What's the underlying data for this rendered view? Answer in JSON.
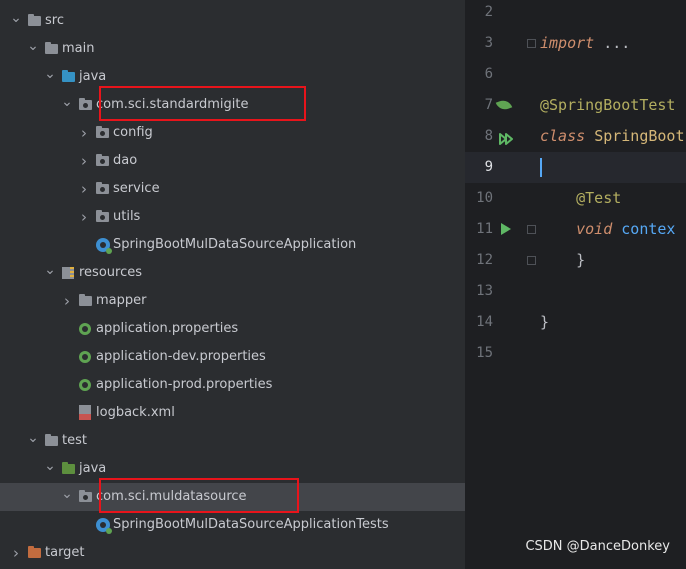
{
  "project_tree": {
    "items": [
      {
        "label": "src",
        "kind": "folder",
        "color": "gray",
        "arrow": "down",
        "depth": 0
      },
      {
        "label": "main",
        "kind": "folder",
        "color": "gray",
        "arrow": "down",
        "depth": 1
      },
      {
        "label": "java",
        "kind": "folder",
        "color": "blue",
        "arrow": "down",
        "depth": 2
      },
      {
        "label": "com.sci.standardmigite",
        "kind": "package",
        "arrow": "down",
        "depth": 3,
        "highlighted": true
      },
      {
        "label": "config",
        "kind": "package",
        "arrow": "right",
        "depth": 4
      },
      {
        "label": "dao",
        "kind": "package",
        "arrow": "right",
        "depth": 4
      },
      {
        "label": "service",
        "kind": "package",
        "arrow": "right",
        "depth": 4
      },
      {
        "label": "utils",
        "kind": "package",
        "arrow": "right",
        "depth": 4
      },
      {
        "label": "SpringBootMulDataSourceApplication",
        "kind": "spring-class",
        "depth": 4
      },
      {
        "label": "resources",
        "kind": "resources",
        "arrow": "down",
        "depth": 2
      },
      {
        "label": "mapper",
        "kind": "folder",
        "color": "gray",
        "arrow": "right",
        "depth": 3
      },
      {
        "label": "application.properties",
        "kind": "spring-config",
        "depth": 3
      },
      {
        "label": "application-dev.properties",
        "kind": "spring-config",
        "depth": 3
      },
      {
        "label": "application-prod.properties",
        "kind": "spring-config",
        "depth": 3
      },
      {
        "label": "logback.xml",
        "kind": "xml",
        "depth": 3
      },
      {
        "label": "test",
        "kind": "folder",
        "color": "gray",
        "arrow": "down",
        "depth": 1
      },
      {
        "label": "java",
        "kind": "folder",
        "color": "green",
        "arrow": "down",
        "depth": 2
      },
      {
        "label": "com.sci.muldatasource",
        "kind": "package",
        "arrow": "down",
        "depth": 3,
        "highlighted": true,
        "selected": true
      },
      {
        "label": "SpringBootMulDataSourceApplicationTests",
        "kind": "spring-class",
        "depth": 4
      },
      {
        "label": "target",
        "kind": "folder",
        "color": "orange",
        "arrow": "right",
        "depth": 0
      }
    ]
  },
  "editor": {
    "lines": [
      {
        "number": "2",
        "tokens": []
      },
      {
        "number": "3",
        "tokens": [
          {
            "t": "import ",
            "c": "kw"
          },
          {
            "t": "...",
            "c": "plain"
          }
        ],
        "fold": true
      },
      {
        "number": "6",
        "tokens": []
      },
      {
        "number": "7",
        "tokens": [
          {
            "t": "@SpringBootTest",
            "c": "ann"
          }
        ],
        "gutter": "spring-leaf-icon"
      },
      {
        "number": "8",
        "tokens": [
          {
            "t": "class ",
            "c": "kw"
          },
          {
            "t": "SpringBoot",
            "c": "cls"
          }
        ],
        "gutter": "run-all-icon"
      },
      {
        "number": "9",
        "tokens": [],
        "current": true
      },
      {
        "number": "10",
        "tokens": [
          {
            "t": "    @Test",
            "c": "ann"
          }
        ]
      },
      {
        "number": "11",
        "tokens": [
          {
            "t": "    ",
            "c": "plain"
          },
          {
            "t": "void ",
            "c": "kw"
          },
          {
            "t": "contex",
            "c": "fn"
          }
        ],
        "gutter": "run-icon",
        "fold": true
      },
      {
        "number": "12",
        "tokens": [
          {
            "t": "    }",
            "c": "plain"
          }
        ],
        "fold": true
      },
      {
        "number": "13",
        "tokens": []
      },
      {
        "number": "14",
        "tokens": [
          {
            "t": "}",
            "c": "plain"
          }
        ]
      },
      {
        "number": "15",
        "tokens": []
      }
    ]
  },
  "colors": {
    "tree_bg": "#2b2d30",
    "editor_bg": "#1e1f22",
    "highlight_box": "#e8141b",
    "selection": "#43454a"
  },
  "watermark": "CSDN @DanceDonkey"
}
